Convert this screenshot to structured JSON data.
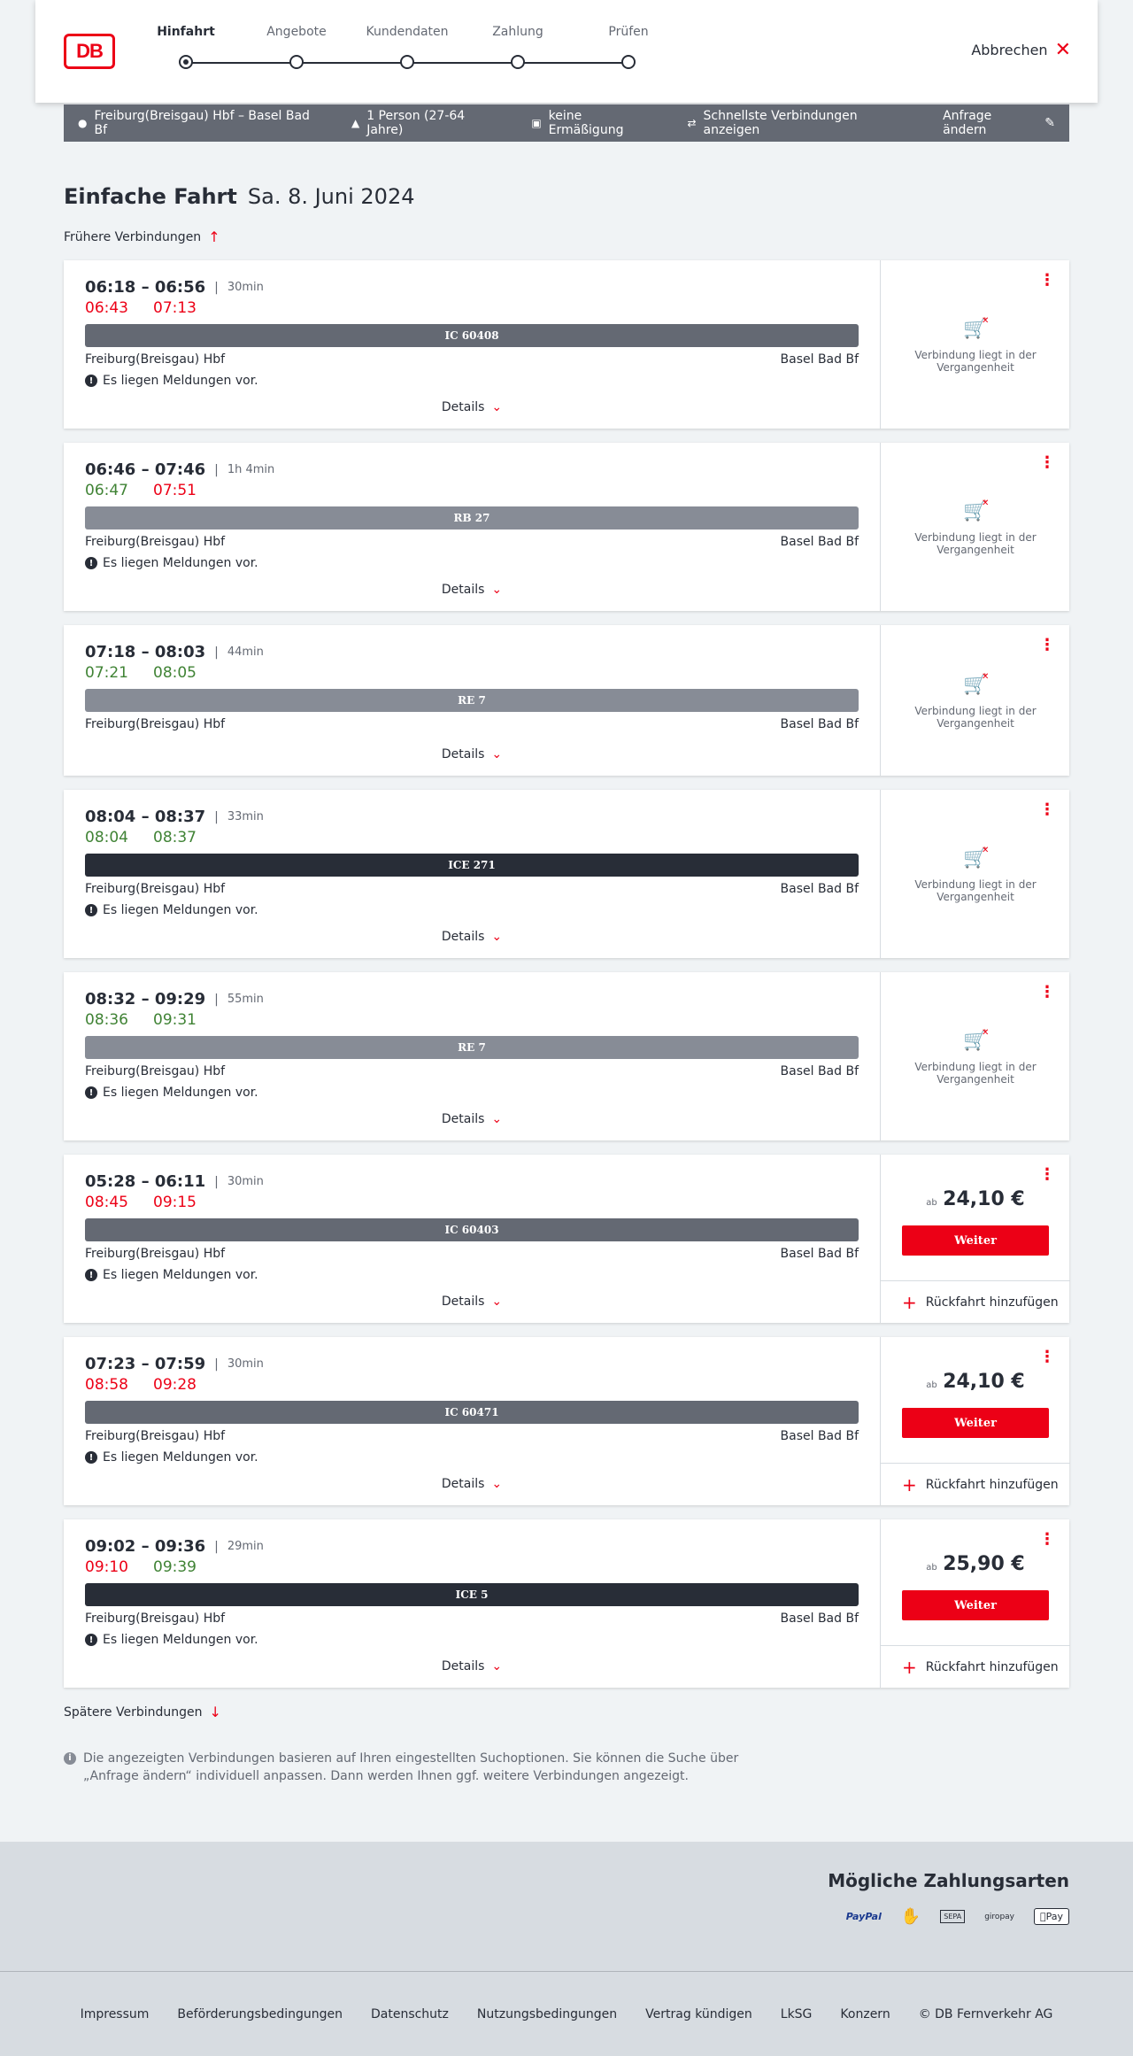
{
  "header": {
    "logo": "DB",
    "steps": [
      "Hinfahrt",
      "Angebote",
      "Kundendaten",
      "Zahlung",
      "Prüfen"
    ],
    "active_step": 0,
    "cancel_label": "Abbrechen"
  },
  "search": {
    "route": "Freiburg(Breisgau) Hbf – Basel Bad Bf",
    "passengers": "1 Person (27-64 Jahre)",
    "discount": "keine Ermäßigung",
    "fastest": "Schnellste Verbindungen anzeigen",
    "change_label": "Anfrage ändern"
  },
  "title": {
    "main": "Einfache Fahrt",
    "date": "Sa. 8. Juni 2024"
  },
  "earlier_label": "Frühere Verbindungen",
  "later_label": "Spätere Verbindungen",
  "details_label": "Details",
  "message_text": "Es liegen Meldungen vor.",
  "past_text": "Verbindung liegt in der Vergangenheit",
  "weiter_label": "Weiter",
  "return_label": "Rückfahrt hinzufügen",
  "price_prefix": "ab",
  "connections": [
    {
      "times": "06:18 – 06:56",
      "duration": "30min",
      "rt_dep": "06:43",
      "rt_arr": "07:13",
      "rt_dep_status": "late",
      "rt_arr_status": "late",
      "train": "IC 60408",
      "train_type": "ic",
      "from": "Freiburg(Breisgau) Hbf",
      "to": "Basel Bad Bf",
      "has_message": true,
      "past": true
    },
    {
      "times": "06:46 – 07:46",
      "duration": "1h 4min",
      "rt_dep": "06:47",
      "rt_arr": "07:51",
      "rt_dep_status": "ontime",
      "rt_arr_status": "late",
      "train": "RB 27",
      "train_type": "rb",
      "from": "Freiburg(Breisgau) Hbf",
      "to": "Basel Bad Bf",
      "has_message": true,
      "past": true
    },
    {
      "times": "07:18 – 08:03",
      "duration": "44min",
      "rt_dep": "07:21",
      "rt_arr": "08:05",
      "rt_dep_status": "ontime",
      "rt_arr_status": "ontime",
      "train": "RE 7",
      "train_type": "rb",
      "from": "Freiburg(Breisgau) Hbf",
      "to": "Basel Bad Bf",
      "has_message": false,
      "past": true
    },
    {
      "times": "08:04 – 08:37",
      "duration": "33min",
      "rt_dep": "08:04",
      "rt_arr": "08:37",
      "rt_dep_status": "ontime",
      "rt_arr_status": "ontime",
      "train": "ICE 271",
      "train_type": "ice",
      "from": "Freiburg(Breisgau) Hbf",
      "to": "Basel Bad Bf",
      "has_message": true,
      "past": true
    },
    {
      "times": "08:32 – 09:29",
      "duration": "55min",
      "rt_dep": "08:36",
      "rt_arr": "09:31",
      "rt_dep_status": "ontime",
      "rt_arr_status": "ontime",
      "train": "RE 7",
      "train_type": "rb",
      "from": "Freiburg(Breisgau) Hbf",
      "to": "Basel Bad Bf",
      "has_message": true,
      "past": true
    },
    {
      "times": "05:28 – 06:11",
      "duration": "30min",
      "rt_dep": "08:45",
      "rt_arr": "09:15",
      "rt_dep_status": "late",
      "rt_arr_status": "late",
      "train": "IC 60403",
      "train_type": "ic",
      "from": "Freiburg(Breisgau) Hbf",
      "to": "Basel Bad Bf",
      "has_message": true,
      "past": false,
      "price": "24,10 €"
    },
    {
      "times": "07:23 – 07:59",
      "duration": "30min",
      "rt_dep": "08:58",
      "rt_arr": "09:28",
      "rt_dep_status": "late",
      "rt_arr_status": "late",
      "train": "IC 60471",
      "train_type": "ic",
      "from": "Freiburg(Breisgau) Hbf",
      "to": "Basel Bad Bf",
      "has_message": true,
      "past": false,
      "price": "24,10 €"
    },
    {
      "times": "09:02 – 09:36",
      "duration": "29min",
      "rt_dep": "09:10",
      "rt_arr": "09:39",
      "rt_dep_status": "late",
      "rt_arr_status": "ontime",
      "train": "ICE 5",
      "train_type": "ice",
      "from": "Freiburg(Breisgau) Hbf",
      "to": "Basel Bad Bf",
      "has_message": true,
      "past": false,
      "price": "25,90 €"
    }
  ],
  "info_text": "Die angezeigten Verbindungen basieren auf Ihren eingestellten Suchoptionen. Sie können die Suche über „Anfrage ändern“ individuell anpassen. Dann werden Ihnen ggf. weitere Verbindungen angezeigt.",
  "payment": {
    "title": "Mögliche Zahlungsarten",
    "methods": [
      "PayPal",
      "Kreditkarte",
      "SEPA",
      "giropay",
      "Apple Pay"
    ],
    "labels": {
      "paypal": "PayPal",
      "sepa": "SEPA",
      "giropay": "giropay",
      "applepay": "Pay"
    }
  },
  "footer_links": [
    "Impressum",
    "Beförderungsbedingungen",
    "Datenschutz",
    "Nutzungsbedingungen",
    "Vertrag kündigen",
    "LkSG",
    "Konzern",
    "© DB Fernverkehr AG"
  ],
  "colors": {
    "brand_red": "#ec0016",
    "delay_red": "#ec0016",
    "ontime_green": "#408335",
    "text": "#282d37"
  }
}
